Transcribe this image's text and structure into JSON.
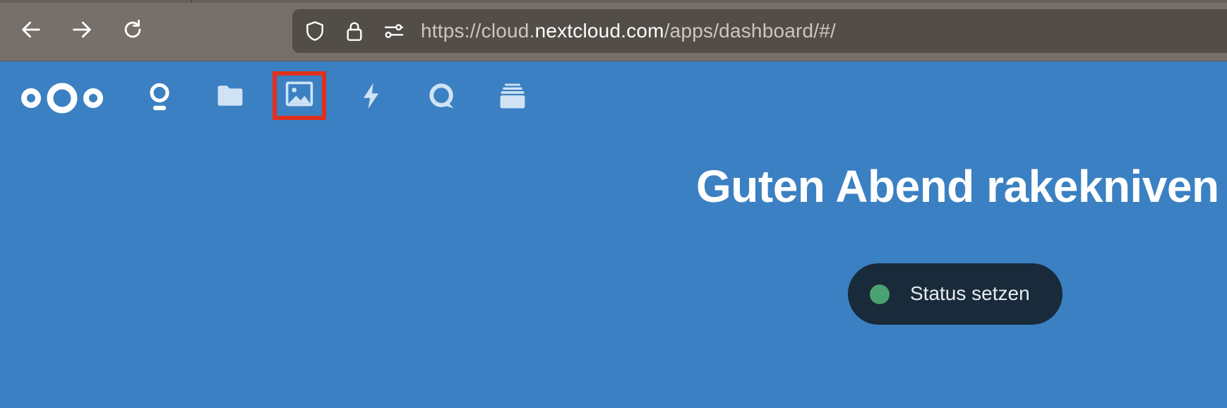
{
  "browser": {
    "url": {
      "prefix": "https://cloud.",
      "host": "nextcloud.com",
      "path": "/apps/dashboard/#/"
    },
    "icons": {
      "back": "arrow-left-icon",
      "forward": "arrow-right-icon",
      "reload": "reload-icon",
      "shield": "shield-icon",
      "lock": "lock-icon",
      "permissions": "tune-icon"
    }
  },
  "header": {
    "logo": "nextcloud-logo",
    "apps": [
      {
        "name": "Dashboard",
        "icon": "dashboard-icon"
      },
      {
        "name": "Files",
        "icon": "folder-icon"
      },
      {
        "name": "Photos",
        "icon": "image-icon",
        "highlighted": true
      },
      {
        "name": "Activity",
        "icon": "lightning-icon"
      },
      {
        "name": "Talk",
        "icon": "talk-bubble-icon"
      },
      {
        "name": "Deck",
        "icon": "deck-icon"
      }
    ]
  },
  "main": {
    "greeting": "Guten Abend rakekniven",
    "status_button": {
      "label": "Status setzen",
      "status_color": "#4aa271"
    }
  },
  "colors": {
    "header_bg": "#3b80c2",
    "highlight": "#e0301e",
    "status_button_bg": "#192a3a"
  }
}
